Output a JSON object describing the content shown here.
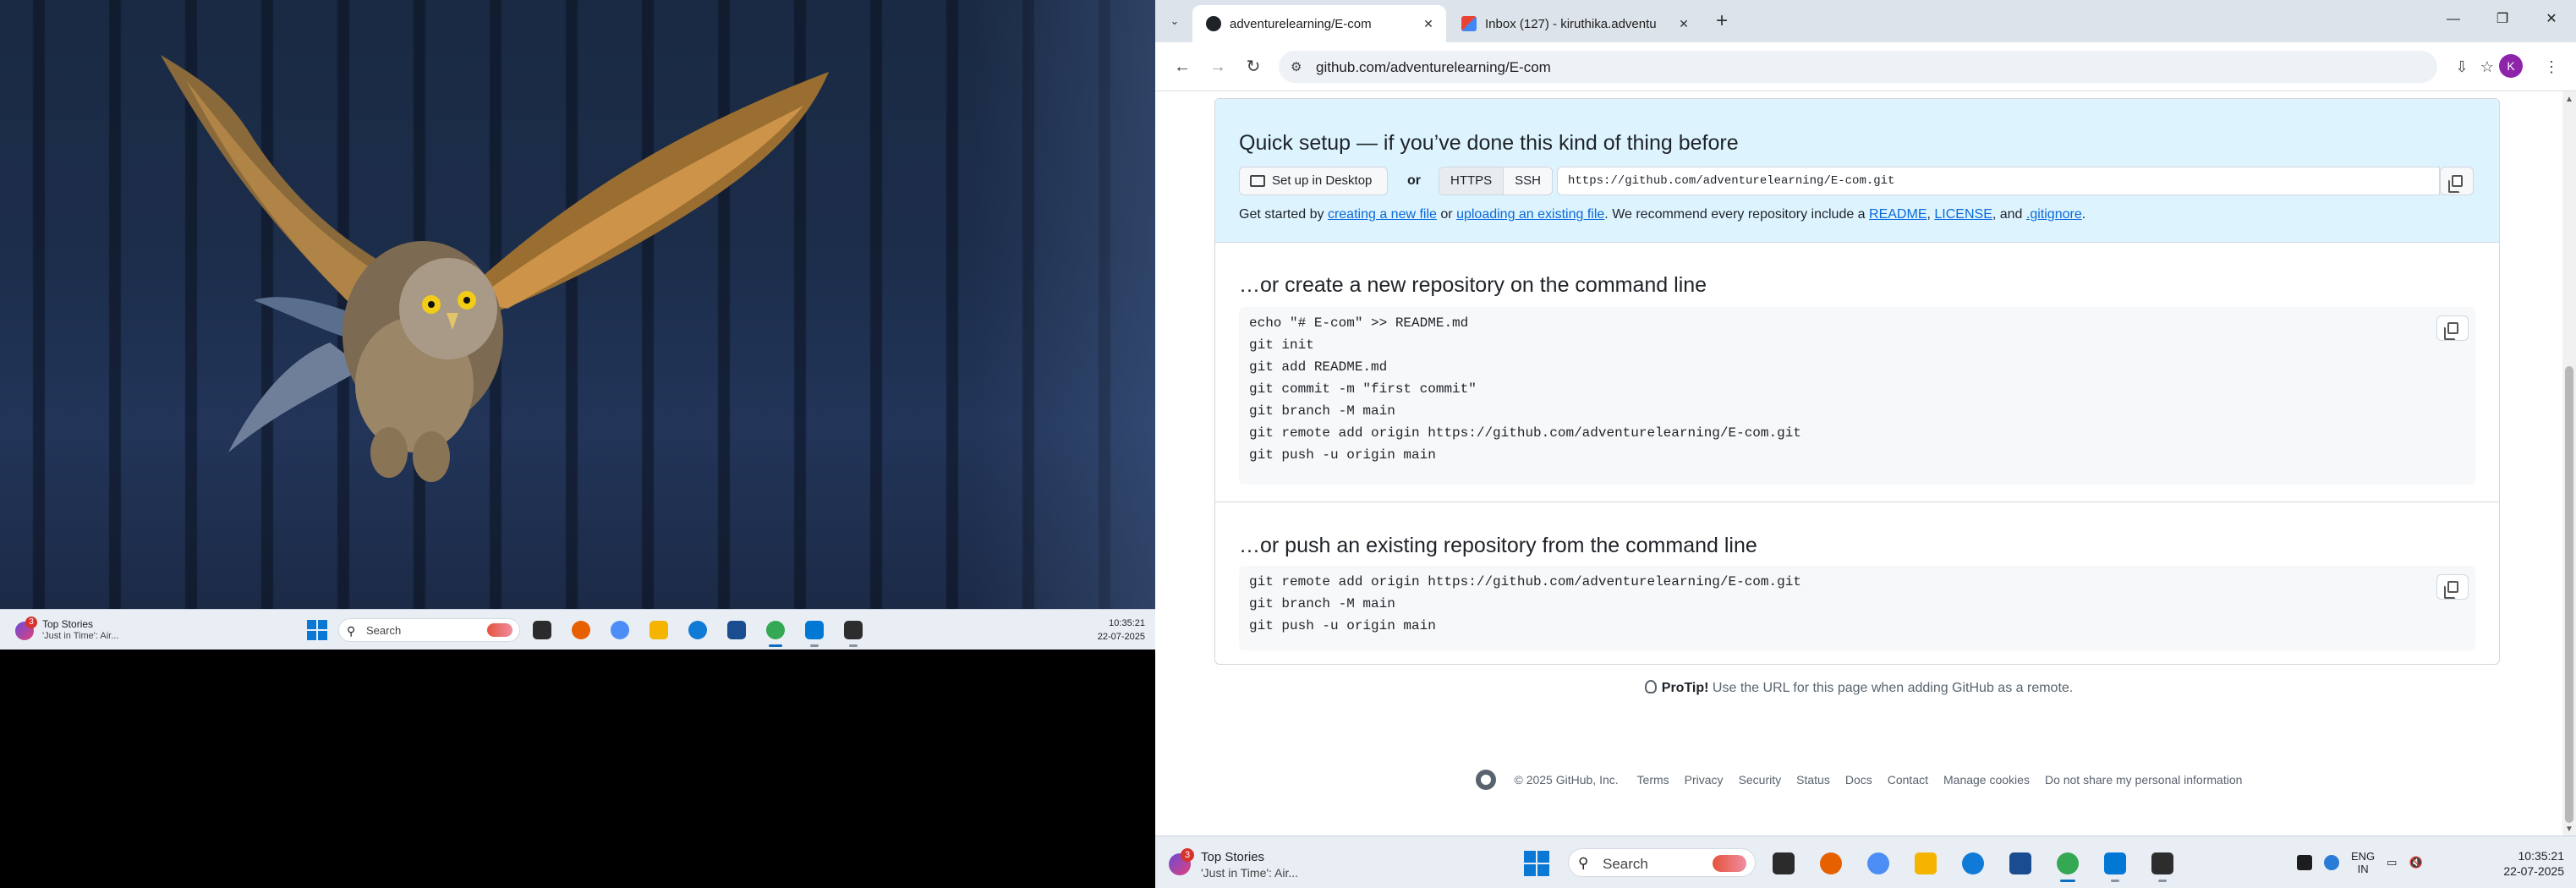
{
  "left_screen": {
    "taskbar": {
      "stories_badge": "3",
      "stories_title": "Top Stories",
      "stories_sub": "'Just in Time': Air...",
      "search_placeholder": "Search",
      "time": "10:35:21",
      "date": "22-07-2025",
      "apps": [
        {
          "name": "file-explorer-dark",
          "color": "#2b2b2b"
        },
        {
          "name": "firefox",
          "color": "#e66000"
        },
        {
          "name": "copilot",
          "color": "#4c8df6"
        },
        {
          "name": "file-explorer",
          "color": "#f4b400"
        },
        {
          "name": "edge",
          "color": "#0f7bd6"
        },
        {
          "name": "store",
          "color": "#1a4d8f"
        },
        {
          "name": "chrome",
          "color": "#34a853"
        },
        {
          "name": "vscode",
          "color": "#0078d4"
        },
        {
          "name": "terminal",
          "color": "#2d2d2d"
        }
      ]
    }
  },
  "browser": {
    "tabs": [
      {
        "title": "adventurelearning/E-com",
        "favicon": "github-icon"
      },
      {
        "title": "Inbox (127) - kiruthika.adventu",
        "favicon": "gmail-icon"
      }
    ],
    "url": "github.com/adventurelearning/E-com",
    "avatar_letter": "K"
  },
  "page": {
    "quick_setup": {
      "title": "Quick setup — if you’ve done this kind of thing before",
      "setup_desktop": "Set up in Desktop",
      "or": "or",
      "https": "HTTPS",
      "ssh": "SSH",
      "clone_url": "https://github.com/adventurelearning/E-com.git",
      "started_prefix": "Get started by",
      "link_new_file": "creating a new file",
      "or_word": "or",
      "link_upload": "uploading an existing file",
      "recommend": ". We recommend every repository include a",
      "link_readme": "README",
      "comma": ",",
      "link_license": "LICENSE",
      "and_word": ", and",
      "link_gitignore": ".gitignore",
      "period": "."
    },
    "create_section": {
      "title": "…or create a new repository on the command line",
      "lines": [
        "echo \"# E-com\" >> README.md",
        "git init",
        "git add README.md",
        "git commit -m \"first commit\"",
        "git branch -M main",
        "git remote add origin https://github.com/adventurelearning/E-com.git",
        "git push -u origin main"
      ]
    },
    "push_section": {
      "title": "…or push an existing repository from the command line",
      "lines": [
        "git remote add origin https://github.com/adventurelearning/E-com.git",
        "git branch -M main",
        "git push -u origin main"
      ]
    },
    "protip": {
      "label": "ProTip!",
      "text": "Use the URL for this page when adding GitHub as a remote."
    },
    "footer": {
      "copyright": "© 2025 GitHub, Inc.",
      "links": [
        "Terms",
        "Privacy",
        "Security",
        "Status",
        "Docs",
        "Contact",
        "Manage cookies",
        "Do not share my personal information"
      ]
    }
  },
  "right_taskbar": {
    "stories_badge": "3",
    "stories_title": "Top Stories",
    "stories_sub": "'Just in Time': Air...",
    "search_placeholder": "Search",
    "lang_line1": "ENG",
    "lang_line2": "IN",
    "time": "10:35:21",
    "date": "22-07-2025",
    "apps": [
      {
        "name": "file-explorer-dark",
        "color": "#2b2b2b"
      },
      {
        "name": "firefox",
        "color": "#e66000"
      },
      {
        "name": "copilot",
        "color": "#4c8df6"
      },
      {
        "name": "file-explorer",
        "color": "#f4b400"
      },
      {
        "name": "edge",
        "color": "#0f7bd6"
      },
      {
        "name": "store",
        "color": "#1a4d8f"
      },
      {
        "name": "chrome",
        "color": "#34a853"
      },
      {
        "name": "vscode",
        "color": "#0078d4"
      },
      {
        "name": "terminal",
        "color": "#2d2d2d"
      }
    ]
  }
}
